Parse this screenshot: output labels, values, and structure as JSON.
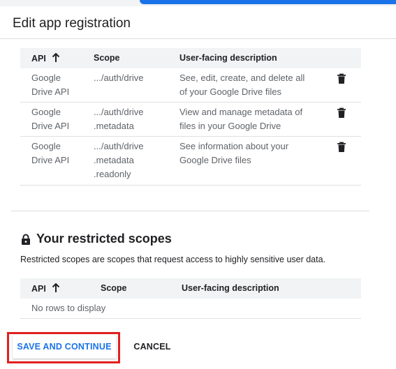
{
  "header": {
    "title": "Edit app registration"
  },
  "scopes_table": {
    "columns": [
      "API",
      "Scope",
      "User-facing description"
    ],
    "sort_icon": "arrow-up-icon",
    "rows": [
      {
        "api": "Google\nDrive API",
        "scope": ".../auth/drive",
        "description": "See, edit, create, and delete all\nof your Google Drive files"
      },
      {
        "api": "Google\nDrive API",
        "scope": ".../auth/drive\n.metadata",
        "description": "View and manage metadata of\nfiles in your Google Drive"
      },
      {
        "api": "Google\nDrive API",
        "scope": ".../auth/drive\n.metadata\n.readonly",
        "description": "See information about your\nGoogle Drive files"
      }
    ],
    "row_action_icon": "trash-icon"
  },
  "restricted": {
    "icon": "lock-icon",
    "title": "Your restricted scopes",
    "description": "Restricted scopes are scopes that request access to highly sensitive user data.",
    "columns": [
      "API",
      "Scope",
      "User-facing description"
    ],
    "empty_message": "No rows to display"
  },
  "actions": {
    "save_label": "SAVE AND CONTINUE",
    "cancel_label": "CANCEL"
  },
  "colors": {
    "accent": "#1a73e8",
    "highlight": "#e0201f",
    "header_bg": "#f1f3f4"
  }
}
